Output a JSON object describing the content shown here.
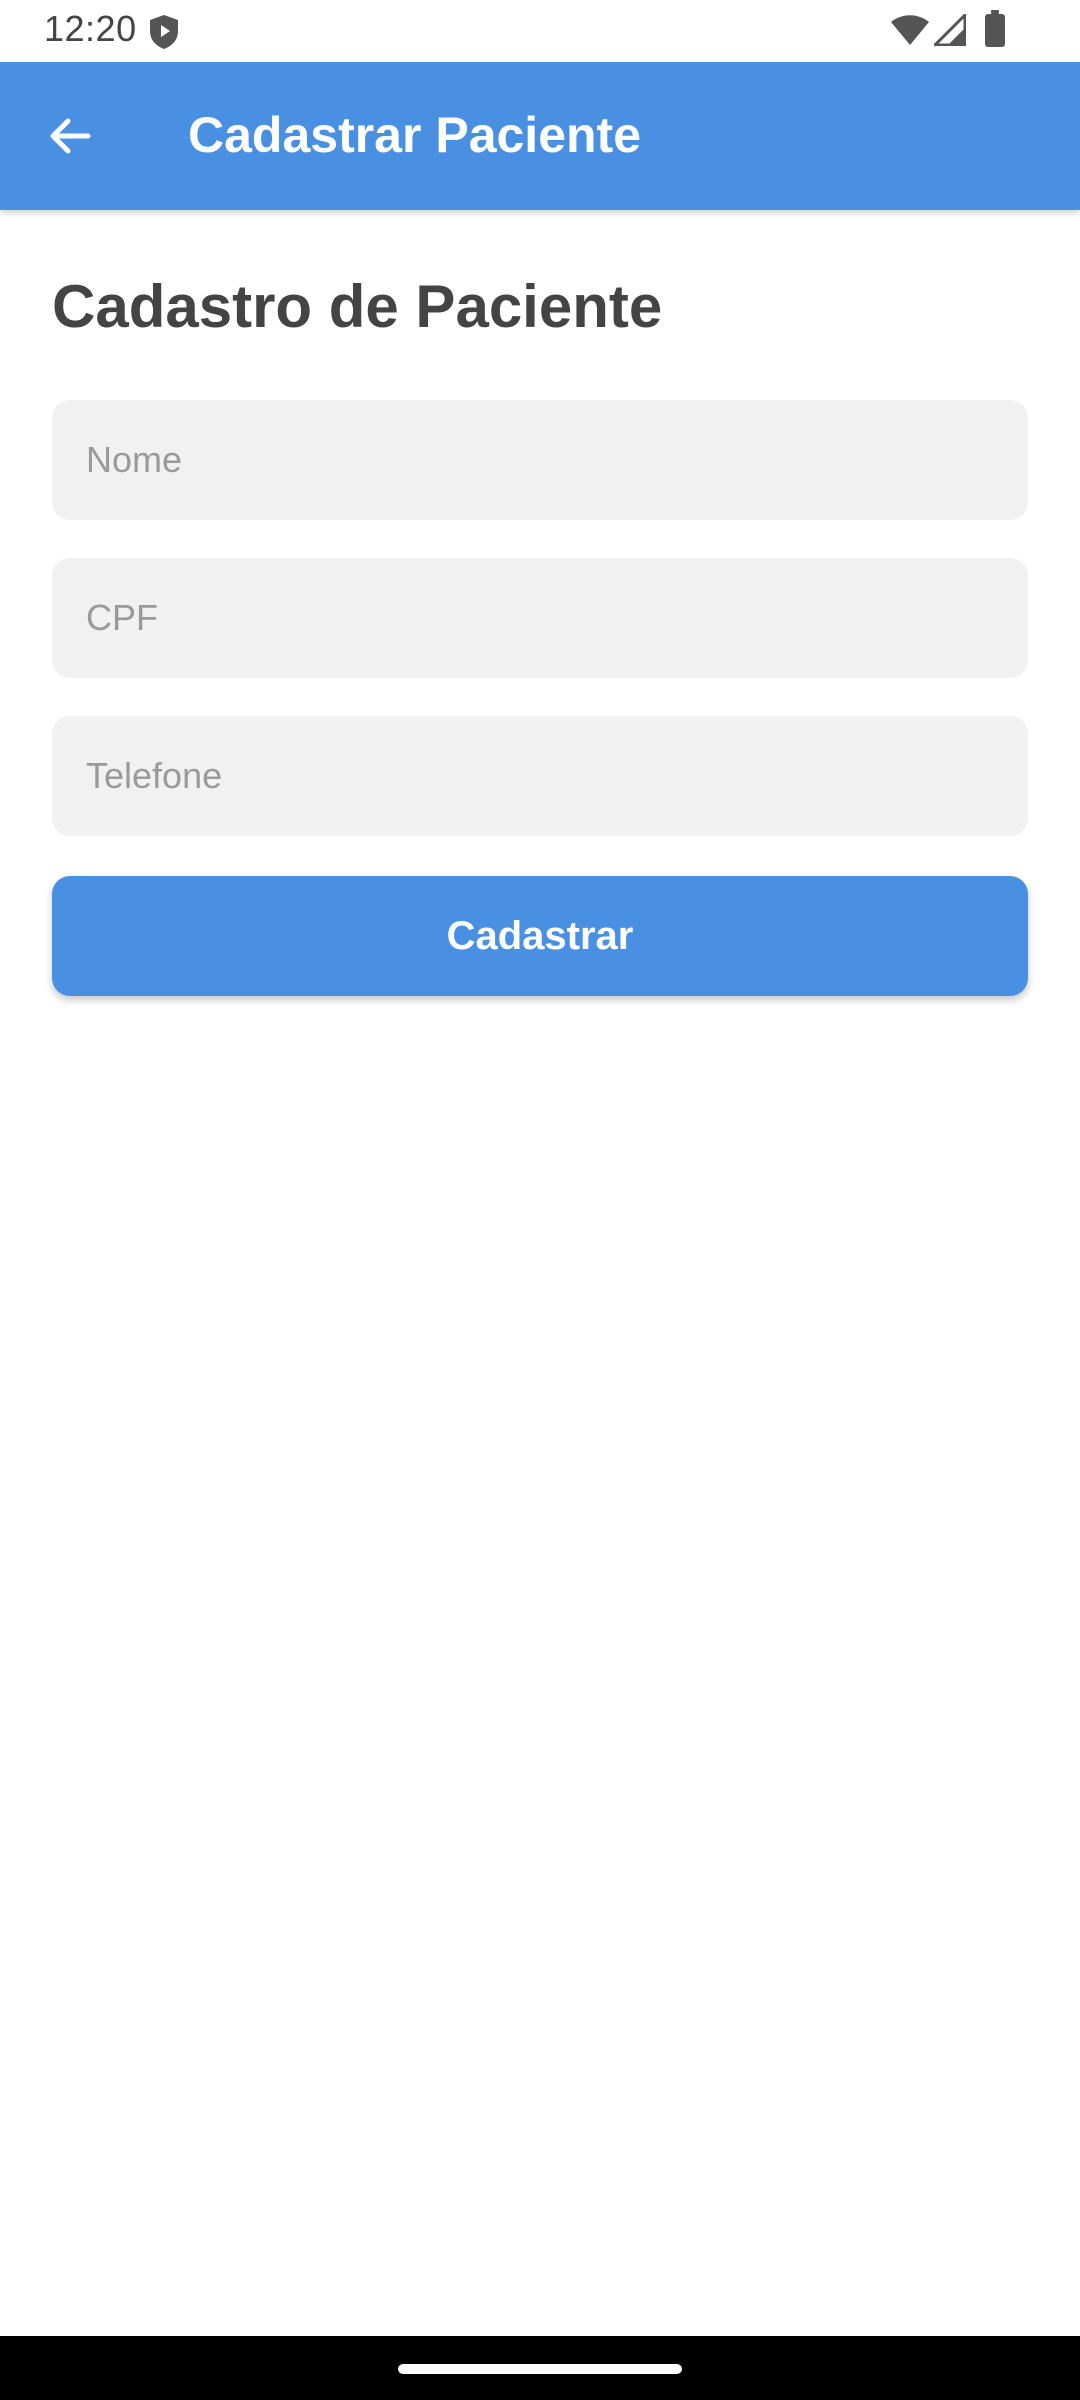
{
  "status_bar": {
    "time": "12:20",
    "icons": [
      "shield-icon",
      "wifi-icon",
      "signal-icon",
      "battery-icon"
    ]
  },
  "app_bar": {
    "title": "Cadastrar Paciente",
    "back_icon": "arrow-back-icon",
    "background_color": "#4a90e2"
  },
  "form": {
    "heading": "Cadastro de Paciente",
    "fields": {
      "nome": {
        "placeholder": "Nome",
        "value": ""
      },
      "cpf": {
        "placeholder": "CPF",
        "value": ""
      },
      "telefone": {
        "placeholder": "Telefone",
        "value": ""
      }
    },
    "submit_label": "Cadastrar",
    "accent_color": "#4a90e2"
  }
}
